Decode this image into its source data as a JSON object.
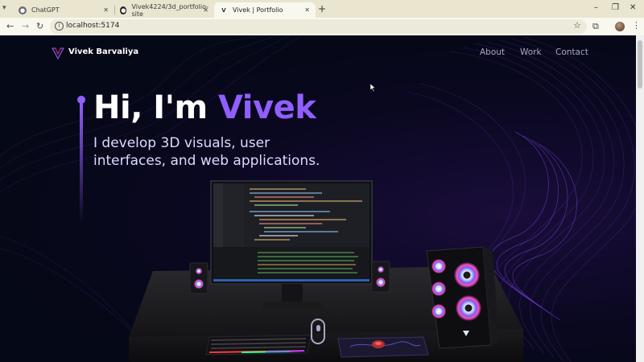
{
  "browser": {
    "tabs": [
      {
        "title": "ChatGPT",
        "icon": "chatgpt-icon",
        "active": false
      },
      {
        "title": "Vivek4224/3d_portfolio-site",
        "icon": "github-icon",
        "active": false
      },
      {
        "title": "Vivek | Portfolio",
        "icon": "vite-logo-icon",
        "active": true
      }
    ],
    "new_tab": "+",
    "url": "localhost:5174",
    "window_controls": [
      "–",
      "❐",
      "✕"
    ]
  },
  "site": {
    "brand": "Vivek  Barvaliya",
    "nav": [
      {
        "label": "About"
      },
      {
        "label": "Work"
      },
      {
        "label": "Contact"
      }
    ],
    "hero": {
      "greeting": "Hi, I'm ",
      "name": "Vivek",
      "subtitle": "I develop 3D visuals, user interfaces, and web applications."
    },
    "colors": {
      "accent": "#915eff",
      "background": "#050816",
      "nav_text": "#aaa6c3",
      "subtitle": "#dfd9ff"
    }
  }
}
